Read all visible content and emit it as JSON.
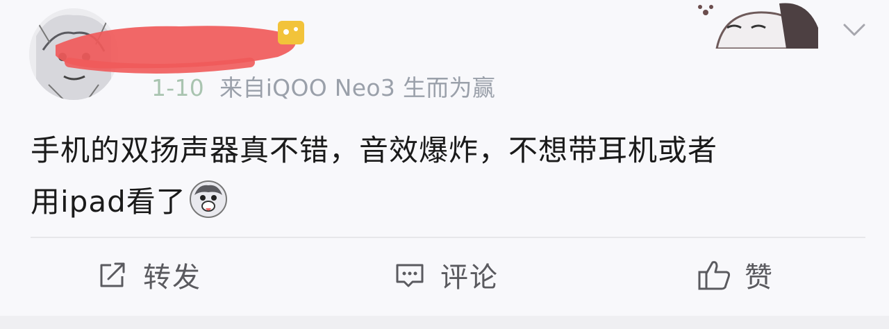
{
  "post": {
    "meta": {
      "time": "1-10",
      "source": "来自iQOO Neo3 生而为赢"
    },
    "content": {
      "line1": "手机的双扬声器真不错，音效爆炸，不想带耳机或者",
      "line2": "用ipad看了"
    },
    "actions": {
      "repost_label": "转发",
      "comment_label": "评论",
      "like_label": "赞"
    },
    "icons": {
      "avatar": "manga-avatar",
      "header_sticker": "cat-sticker",
      "menu": "chevron-down-icon",
      "inline_emoji": "husky-emoji",
      "repost": "share-icon",
      "comment": "comment-icon",
      "like": "thumbs-up-icon"
    },
    "colors": {
      "redaction": "#f05a5a",
      "meta_text": "#98a0ad",
      "body_text": "#1a1a1a",
      "action_text": "#5a5a5f"
    }
  }
}
